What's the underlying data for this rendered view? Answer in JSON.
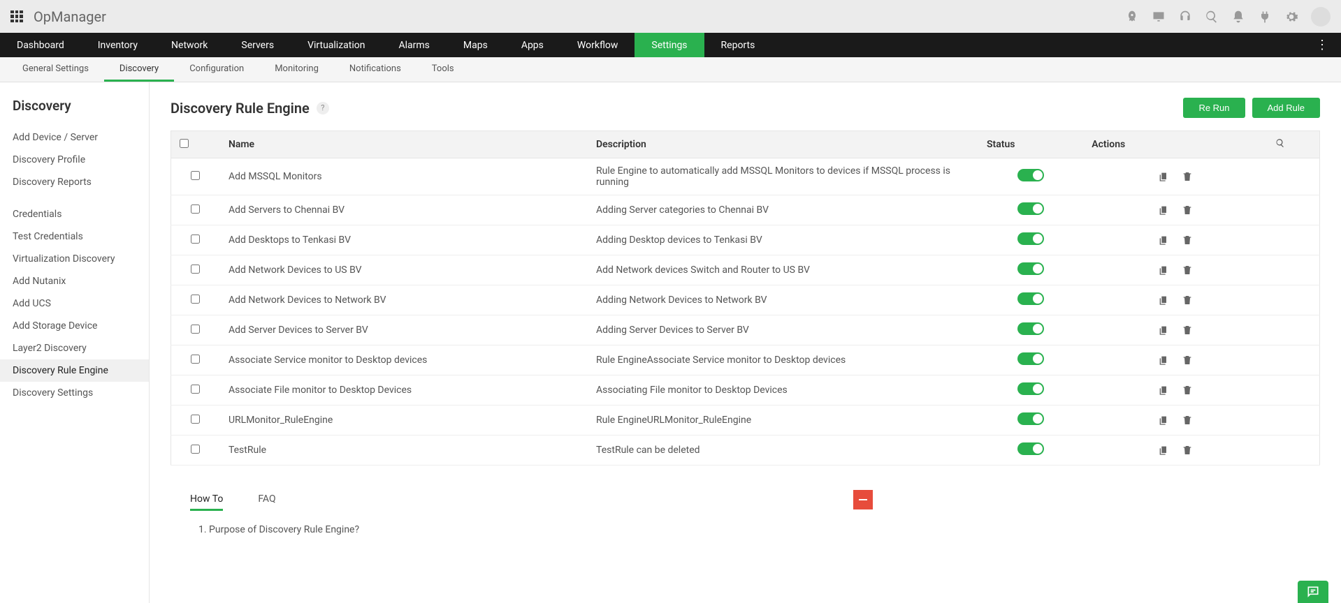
{
  "app_title": "OpManager",
  "main_nav": [
    "Dashboard",
    "Inventory",
    "Network",
    "Servers",
    "Virtualization",
    "Alarms",
    "Maps",
    "Apps",
    "Workflow",
    "Settings",
    "Reports"
  ],
  "main_nav_active": "Settings",
  "sub_nav": [
    "General Settings",
    "Discovery",
    "Configuration",
    "Monitoring",
    "Notifications",
    "Tools"
  ],
  "sub_nav_active": "Discovery",
  "sidebar": {
    "title": "Discovery",
    "group1": [
      "Add Device / Server",
      "Discovery Profile",
      "Discovery Reports"
    ],
    "group2": [
      "Credentials",
      "Test Credentials",
      "Virtualization Discovery",
      "Add Nutanix",
      "Add UCS",
      "Add Storage Device",
      "Layer2 Discovery",
      "Discovery Rule Engine",
      "Discovery Settings"
    ],
    "active": "Discovery Rule Engine"
  },
  "page": {
    "title": "Discovery Rule Engine",
    "help": "?",
    "rerun": "Re Run",
    "addrule": "Add Rule"
  },
  "table": {
    "headers": {
      "name": "Name",
      "description": "Description",
      "status": "Status",
      "actions": "Actions"
    },
    "rows": [
      {
        "name": "Add MSSQL Monitors",
        "desc": "Rule Engine to automatically add MSSQL Monitors to devices if MSSQL process is running"
      },
      {
        "name": "Add Servers to Chennai BV",
        "desc": "Adding Server categories to Chennai BV"
      },
      {
        "name": "Add Desktops to Tenkasi BV",
        "desc": "Adding Desktop devices to Tenkasi BV"
      },
      {
        "name": "Add Network Devices to US BV",
        "desc": "Add Network devices Switch and Router to US BV"
      },
      {
        "name": "Add Network Devices to Network BV",
        "desc": "Adding Network Devices to Network BV"
      },
      {
        "name": "Add Server Devices to Server BV",
        "desc": "Adding Server Devices to Server BV"
      },
      {
        "name": "Associate Service monitor to Desktop devices",
        "desc": "Rule EngineAssociate Service monitor to Desktop devices"
      },
      {
        "name": "Associate File monitor to Desktop Devices",
        "desc": "Associating File monitor to Desktop Devices"
      },
      {
        "name": "URLMonitor_RuleEngine",
        "desc": "Rule EngineURLMonitor_RuleEngine"
      },
      {
        "name": "TestRule",
        "desc": "TestRule can be deleted"
      }
    ]
  },
  "bottom": {
    "tabs": [
      "How To",
      "FAQ"
    ],
    "active": "How To",
    "q1": "1. Purpose of Discovery Rule Engine?"
  }
}
